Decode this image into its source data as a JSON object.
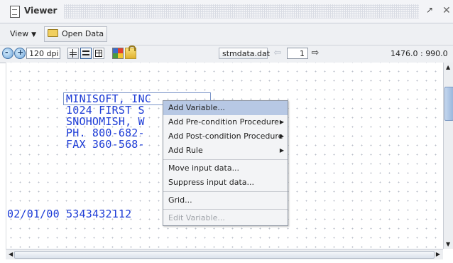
{
  "window": {
    "title": "Viewer"
  },
  "toolbar": {
    "view_label": "View",
    "open_data_label": "Open Data",
    "dpi_value": "120 dpi",
    "data_file": "stmdata.dat",
    "page_number": "1",
    "coordinates": "1476.0 : 990.0"
  },
  "document": {
    "lines": [
      "MINISOFT, INC",
      "1024 FIRST S",
      "SNOHOMISH, W",
      "PH. 800-682-",
      "FAX 360-568-"
    ],
    "bottom_line": "02/01/00 5343432112"
  },
  "context_menu": {
    "items": [
      {
        "label": "Add Variable...",
        "submenu": false,
        "disabled": false
      },
      {
        "label": "Add Pre-condition Procedure",
        "submenu": true,
        "disabled": false
      },
      {
        "label": "Add Post-condition Procedure",
        "submenu": true,
        "disabled": false
      },
      {
        "label": "Add Rule",
        "submenu": true,
        "disabled": false
      },
      {
        "label": "Move input data...",
        "submenu": false,
        "disabled": false
      },
      {
        "label": "Suppress input data...",
        "submenu": false,
        "disabled": false
      },
      {
        "label": "Grid...",
        "submenu": false,
        "disabled": false
      },
      {
        "label": "Edit Variable...",
        "submenu": false,
        "disabled": true
      }
    ]
  },
  "icons": {
    "doc": "document-icon",
    "restore": "restore-icon",
    "close": "close-icon",
    "zoom_out": "zoom-out-icon",
    "zoom_in": "zoom-in-icon",
    "folder": "folder-icon",
    "palette": "palette-icon",
    "lock": "lock-icon"
  },
  "colors": {
    "document_text": "#1c3bd6",
    "menu_highlight": "#b7c8e4"
  }
}
